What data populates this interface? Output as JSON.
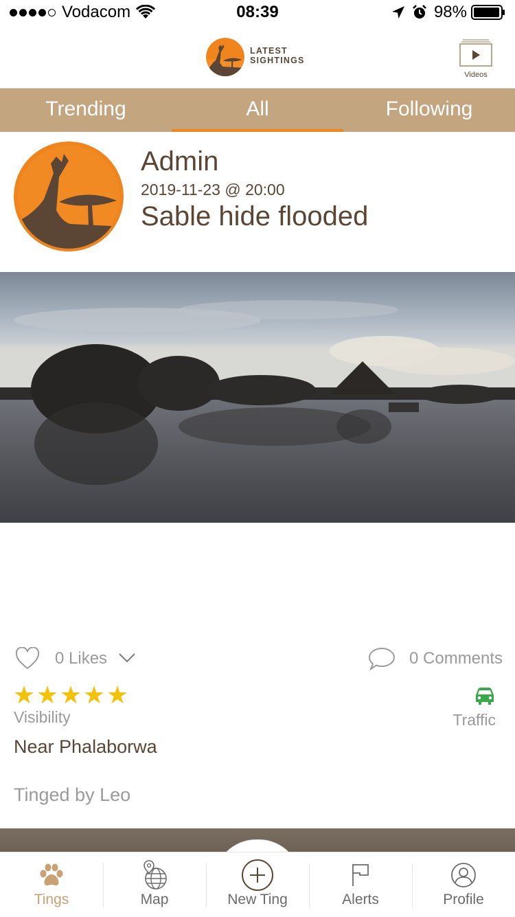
{
  "status_bar": {
    "carrier": "Vodacom",
    "time": "08:39",
    "battery": "98%"
  },
  "header": {
    "logo_line1": "LATEST",
    "logo_line2": "SIGHTINGS",
    "videos_label": "Videos"
  },
  "tabs": [
    {
      "label": "Trending"
    },
    {
      "label": "All",
      "active": true
    },
    {
      "label": "Following"
    }
  ],
  "post": {
    "author": "Admin",
    "date": "2019-11-23 @ 20:00",
    "title": "Sable hide flooded",
    "likes": "0 Likes",
    "comments": "0 Comments",
    "rating_stars": 5,
    "rating_label": "Visibility",
    "traffic_label": "Traffic",
    "location": "Near Phalaborwa",
    "tinged_by": "Tinged by Leo"
  },
  "nav": [
    {
      "label": "Tings",
      "icon": "paw-icon",
      "active": true
    },
    {
      "label": "Map",
      "icon": "globe-pin-icon"
    },
    {
      "label": "New Ting",
      "icon": "plus-circle-icon"
    },
    {
      "label": "Alerts",
      "icon": "flag-icon"
    },
    {
      "label": "Profile",
      "icon": "user-circle-icon"
    }
  ],
  "colors": {
    "brand_brown": "#5b4636",
    "tab_bar": "#c3a57f",
    "accent_orange": "#f0851d",
    "star": "#f2c30a",
    "traffic_green": "#3aa84a",
    "active_nav": "#c9a173"
  }
}
